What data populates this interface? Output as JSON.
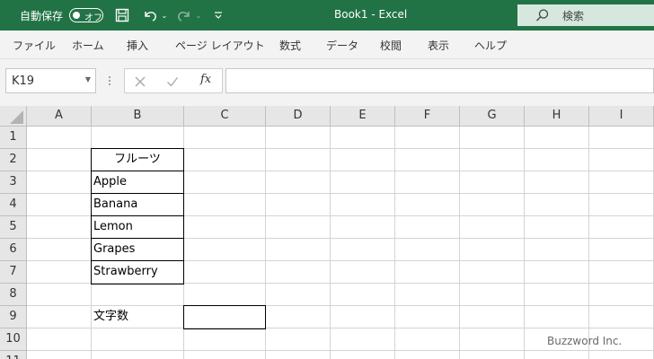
{
  "titlebar": {
    "autosave_label": "自動保存",
    "autosave_state": "オフ",
    "document_title": "Book1  -  Excel",
    "search_label": "検索"
  },
  "ribbon": {
    "tabs": [
      "ファイル",
      "ホーム",
      "挿入",
      "ページ レイアウト",
      "数式",
      "データ",
      "校閲",
      "表示",
      "ヘルプ"
    ]
  },
  "formula_bar": {
    "name_box": "K19",
    "formula": "",
    "fx": "fx"
  },
  "sheet": {
    "columns": [
      "A",
      "B",
      "C",
      "D",
      "E",
      "F",
      "G",
      "H",
      "I"
    ],
    "rows": [
      "1",
      "2",
      "3",
      "4",
      "5",
      "6",
      "7",
      "8",
      "9",
      "10",
      "11"
    ],
    "cells": {
      "B2": "フルーツ",
      "B3": "Apple",
      "B4": "Banana",
      "B5": "Lemon",
      "B6": "Grapes",
      "B7": "Strawberry",
      "B9": "文字数",
      "C9": ""
    }
  },
  "watermark": "Buzzword Inc."
}
